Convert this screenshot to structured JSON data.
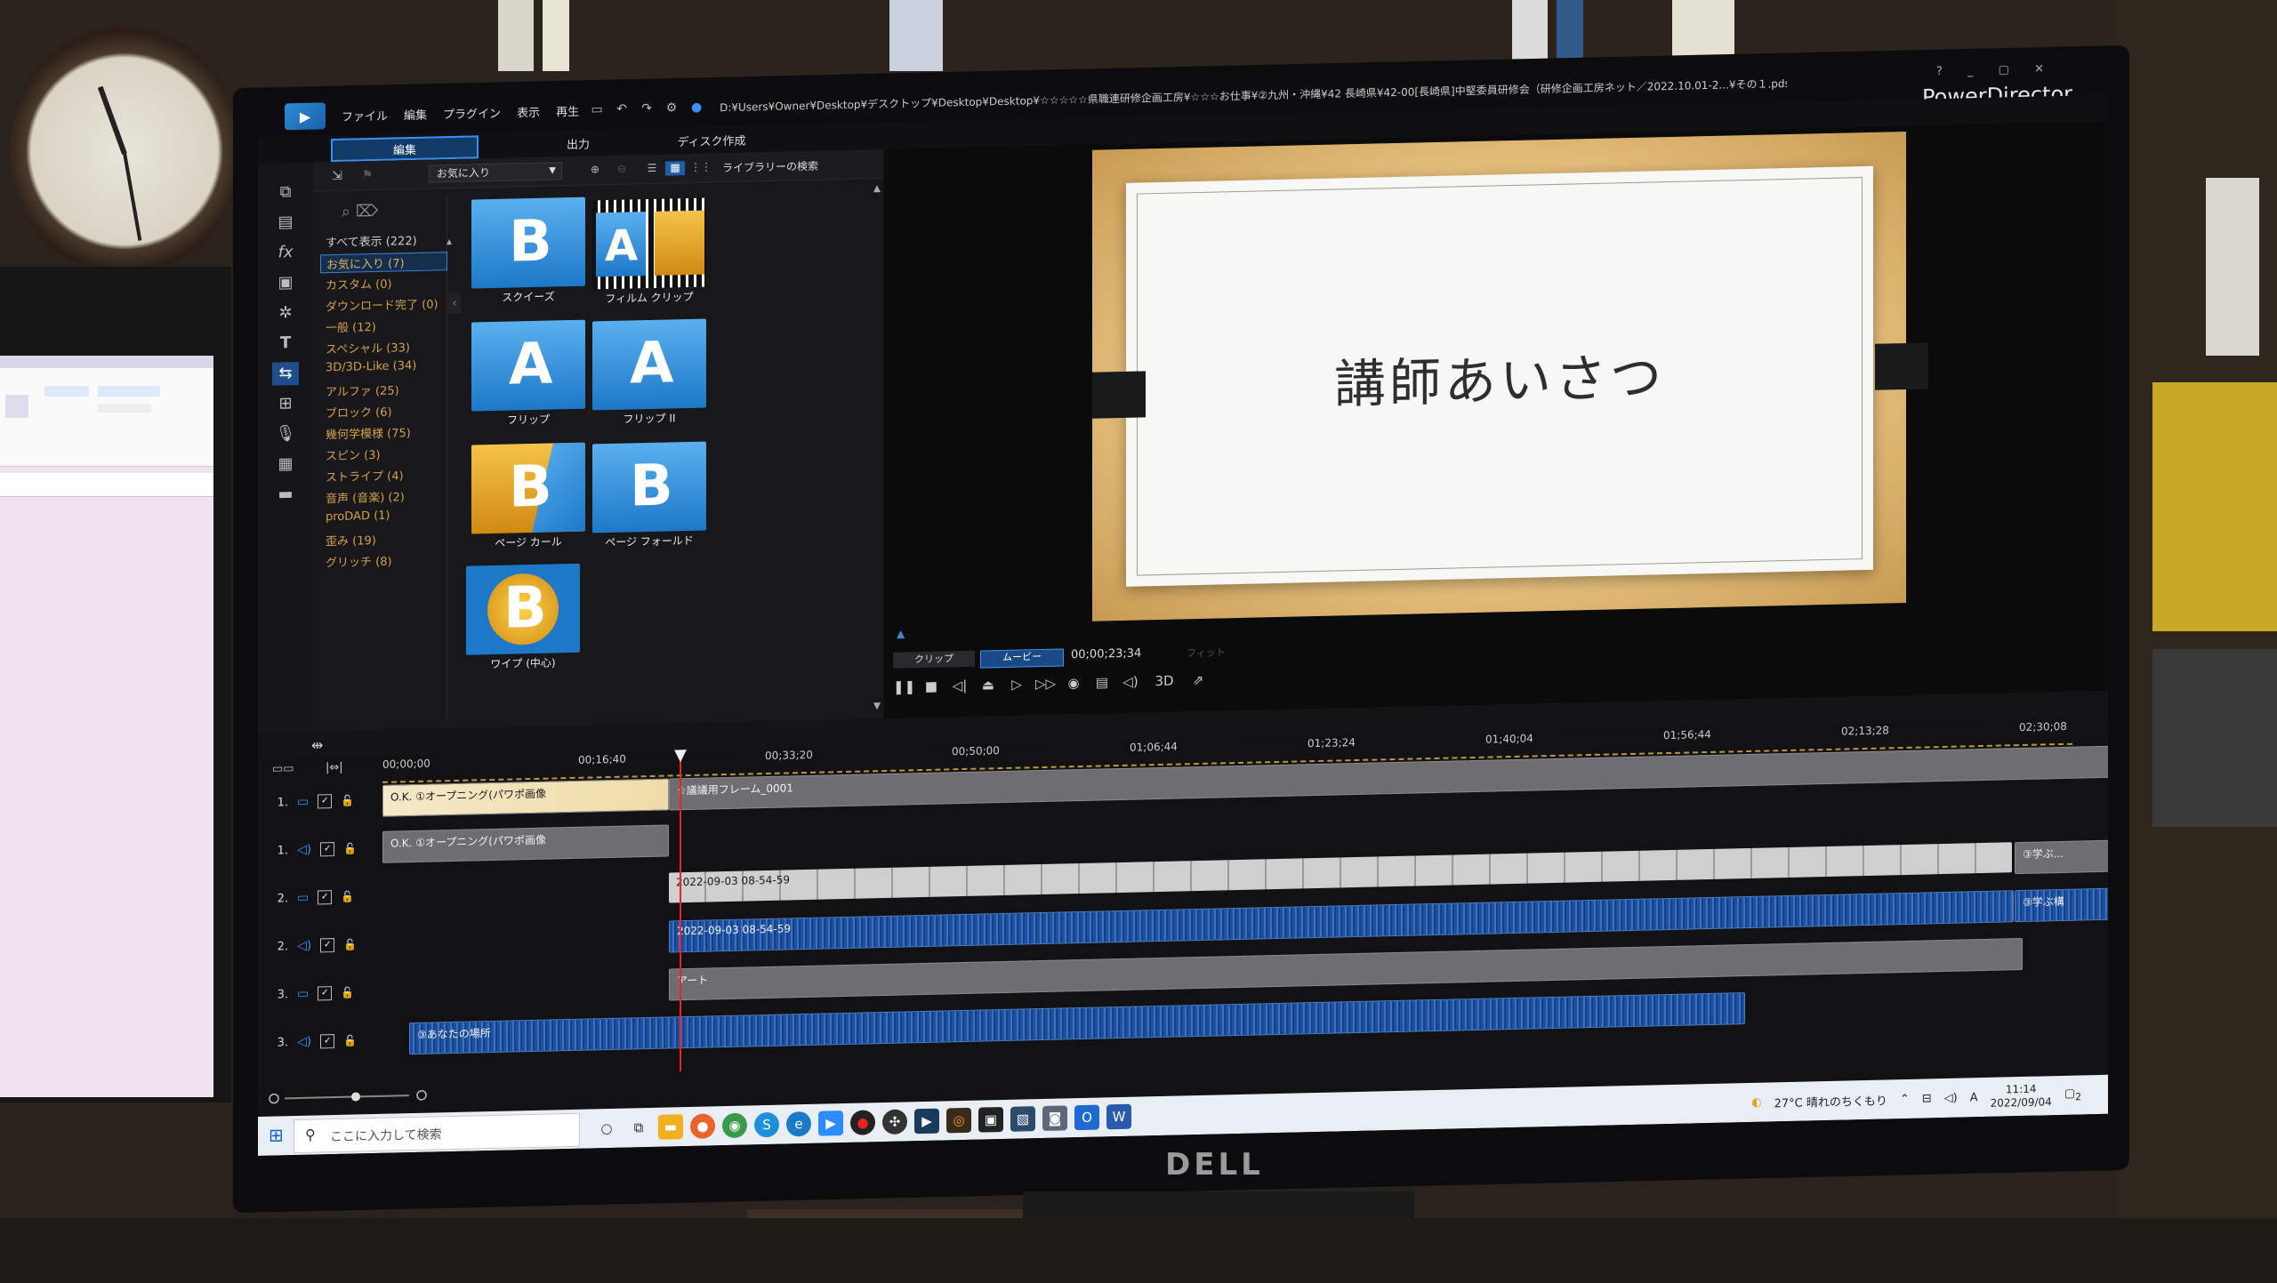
{
  "app": {
    "brand": "PowerDirector",
    "menu": [
      "ファイル",
      "編集",
      "プラグイン",
      "表示",
      "再生"
    ],
    "file_path": "D:¥Users¥Owner¥Desktop¥デスクトップ¥Desktop¥Desktop¥☆☆☆☆☆県職連研修企画工房¥☆☆☆お仕事¥②九州・沖縄¥42 長崎県¥42-00[長崎県]中堅委員研修会（研修企画工房ネット／2022.10.01-2...¥その１.pds",
    "window_controls": "? _ ▢ ✕"
  },
  "modes": {
    "edit": "編集",
    "output": "出力",
    "disc": "ディスク作成"
  },
  "library": {
    "filter_value": "お気に入り",
    "search_placeholder": "ライブラリーの検索",
    "categories": [
      {
        "label": "すべて表示 (222)",
        "type": "all"
      },
      {
        "label": "お気に入り (7)",
        "type": "sel"
      },
      {
        "label": "カスタム (0)",
        "type": ""
      },
      {
        "label": "ダウンロード完了 (0)",
        "type": ""
      },
      {
        "label": "一般 (12)",
        "type": ""
      },
      {
        "label": "スペシャル (33)",
        "type": ""
      },
      {
        "label": "3D/3D-Like (34)",
        "type": ""
      },
      {
        "label": "アルファ (25)",
        "type": ""
      },
      {
        "label": "ブロック (6)",
        "type": ""
      },
      {
        "label": "幾何学模様 (75)",
        "type": ""
      },
      {
        "label": "スピン (3)",
        "type": ""
      },
      {
        "label": "ストライプ (4)",
        "type": ""
      },
      {
        "label": "音声 (音楽) (2)",
        "type": ""
      },
      {
        "label": "proDAD (1)",
        "type": ""
      },
      {
        "label": "歪み (19)",
        "type": ""
      },
      {
        "label": "グリッチ (8)",
        "type": ""
      }
    ],
    "transitions": [
      {
        "label": "スクイーズ",
        "letter": "B"
      },
      {
        "label": "フィルム クリップ",
        "letter": "A"
      },
      {
        "label": "フリップ",
        "letter": "A"
      },
      {
        "label": "フリップ II",
        "letter": "A"
      },
      {
        "label": "ページ カール",
        "letter": "B"
      },
      {
        "label": "ページ フォールド",
        "letter": "B"
      },
      {
        "label": "ワイプ (中心)",
        "letter": "B"
      }
    ]
  },
  "preview": {
    "slide_title": "講師あいさつ",
    "mode_clip": "クリップ",
    "mode_movie": "ムービー",
    "timecode": "00;00;23;34",
    "fit": "フィット",
    "threed": "3D"
  },
  "timeline": {
    "ruler": [
      "00;00;00",
      "00;16;40",
      "00;33;20",
      "00;50;00",
      "01;06;44",
      "01;23;24",
      "01;40;04",
      "01;56;44",
      "02;13;28",
      "02;30;08"
    ],
    "tracks": [
      {
        "num": "1.",
        "kind": "video"
      },
      {
        "num": "1.",
        "kind": "audio"
      },
      {
        "num": "2.",
        "kind": "video"
      },
      {
        "num": "2.",
        "kind": "audio"
      },
      {
        "num": "3.",
        "kind": "video"
      },
      {
        "num": "3.",
        "kind": "audio"
      }
    ],
    "clips": {
      "v1a": "O.K. ①オープニング(パワポ画像",
      "v1b": "☆議議用フレーム_0001",
      "a1": "O.K. ①オープニング(パワポ画像",
      "v2": "2022-09-03 08-54-59",
      "a2": "2022-09-03 08-54-59",
      "v2b": "③学ぶ...",
      "a2b": "③学ぶ構",
      "v3": "アート",
      "a3": "③あなたの場所"
    }
  },
  "taskbar": {
    "search_placeholder": "ここに入力して検索",
    "weather": "27°C 晴れのちくもり",
    "ime": "A",
    "time": "11:14",
    "date": "2022/09/04",
    "notif": "2"
  }
}
